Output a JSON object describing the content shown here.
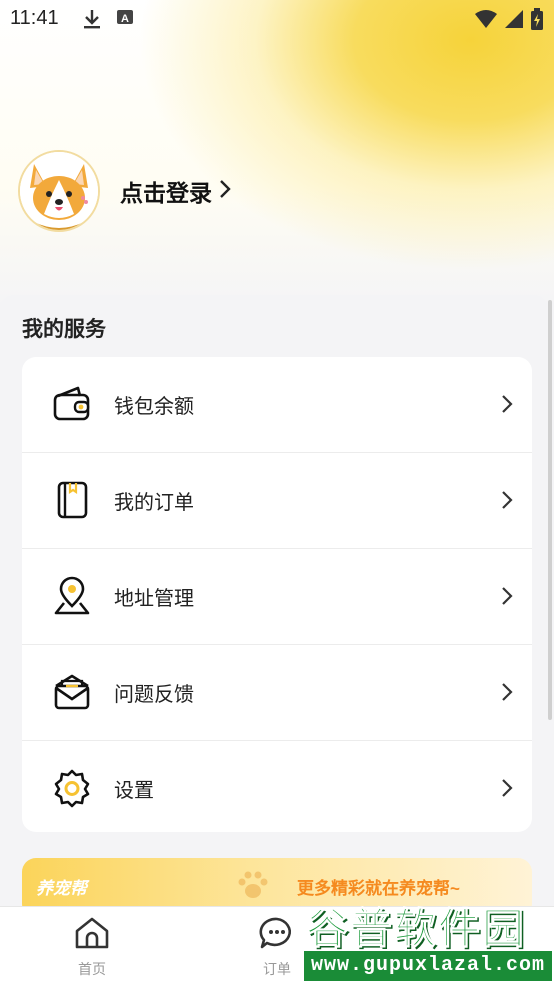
{
  "status_bar": {
    "time": "11:41",
    "left_icons": [
      "download-icon",
      "a-icon"
    ],
    "right_icons": [
      "wifi-icon",
      "signal-icon",
      "battery-icon"
    ]
  },
  "profile": {
    "login_label": "点击登录",
    "avatar_icon": "corgi-avatar-icon"
  },
  "services": {
    "title": "我的服务",
    "items": [
      {
        "label": "钱包余额",
        "icon": "wallet-icon"
      },
      {
        "label": "我的订单",
        "icon": "notebook-icon"
      },
      {
        "label": "地址管理",
        "icon": "location-pin-icon"
      },
      {
        "label": "问题反馈",
        "icon": "mail-icon"
      },
      {
        "label": "设置",
        "icon": "gear-icon"
      }
    ]
  },
  "banner": {
    "brand": "养宠帮",
    "slogan": "更多精彩就在养宠帮~"
  },
  "bottom_nav": {
    "items": [
      {
        "label": "首页",
        "icon": "home-icon"
      },
      {
        "label": "订单",
        "icon": "chat-icon"
      }
    ]
  },
  "watermark": {
    "title": "谷普软件园",
    "url": "www.gupuxlazal.com"
  },
  "colors": {
    "accent_yellow": "#f6d33a",
    "banner_slogan": "#f58a1f",
    "watermark_green": "#1a9a3a"
  }
}
